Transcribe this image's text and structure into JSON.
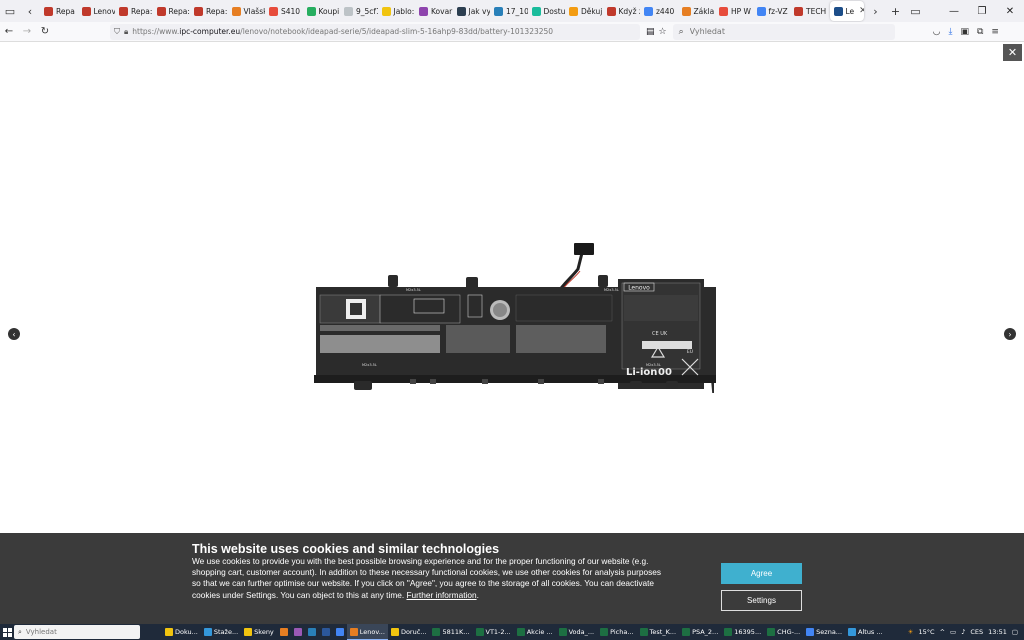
{
  "browser": {
    "tabs": [
      {
        "label": "Repa",
        "color": "#c0392b"
      },
      {
        "label": "Lenov",
        "color": "#c0392b"
      },
      {
        "label": "Repa:",
        "color": "#c0392b"
      },
      {
        "label": "Repa:",
        "color": "#c0392b"
      },
      {
        "label": "Repa:",
        "color": "#c0392b"
      },
      {
        "label": "Vlašsk",
        "color": "#e67e22"
      },
      {
        "label": "S410 (",
        "color": "#e74c3c"
      },
      {
        "label": "Koupi",
        "color": "#27ae60"
      },
      {
        "label": "9_5cf1",
        "color": "#bdc3c7"
      },
      {
        "label": "Jablo:",
        "color": "#f1c40f"
      },
      {
        "label": "Kovar",
        "color": "#8e44ad"
      },
      {
        "label": "Jak vy",
        "color": "#2c3e50"
      },
      {
        "label": "17_10",
        "color": "#2980b9"
      },
      {
        "label": "Dostu",
        "color": "#1abc9c"
      },
      {
        "label": "Děkuj",
        "color": "#f39c12"
      },
      {
        "label": "Když z",
        "color": "#c0392b"
      },
      {
        "label": "z440",
        "color": "#4285f4"
      },
      {
        "label": "Zákla",
        "color": "#e67e22"
      },
      {
        "label": "HP W",
        "color": "#e74c3c"
      },
      {
        "label": "fz-VZ",
        "color": "#4285f4"
      },
      {
        "label": "TECH",
        "color": "#c0392b"
      },
      {
        "label": "Le",
        "color": "#1d4e89",
        "active": true
      }
    ],
    "url_prefix": "https://www.",
    "url_domain": "ipc-computer.eu",
    "url_path": "/lenovo/notebook/ideapad-serie/5/ideapad-slim-5-16ahp9-83dd/battery-101323250",
    "search_placeholder": "Vyhledat"
  },
  "battery_label": {
    "brand": "Lenovo",
    "chem": "Li-ion",
    "screw": "M2x3.5L",
    "eu": "EU"
  },
  "cookie": {
    "title": "This website uses cookies and similar technologies",
    "body": "We use cookies to provide you with the best possible browsing experience and for the proper functioning of our website (e.g. shopping cart, customer account). In addition to these necessary functional cookies, we use other cookies for analysis purposes so that we can further optimise our website. If you click on \"Agree\", you agree to the storage of all cookies. You can deactivate cookies under Settings. You can object to this at any time.",
    "link": "Further information",
    "agree": "Agree",
    "settings": "Settings"
  },
  "taskbar": {
    "search_placeholder": "Vyhledat",
    "items": [
      {
        "label": "Doku...",
        "color": "#f1c40f"
      },
      {
        "label": "Staže...",
        "color": "#3498db"
      },
      {
        "label": "Skeny",
        "color": "#f1c40f"
      },
      {
        "label": "",
        "color": "#e67e22"
      },
      {
        "label": "",
        "color": "#9b59b6"
      },
      {
        "label": "",
        "color": "#2980b9"
      },
      {
        "label": "",
        "color": "#2b579a"
      },
      {
        "label": "",
        "color": "#4285f4"
      },
      {
        "label": "Lenov...",
        "color": "#e67e22",
        "active": true
      },
      {
        "label": "Doruč...",
        "color": "#f1c40f"
      },
      {
        "label": "5811K...",
        "color": "#1d6f42"
      },
      {
        "label": "VT1-2...",
        "color": "#1d6f42"
      },
      {
        "label": "Akcie ...",
        "color": "#1d6f42"
      },
      {
        "label": "Voda_...",
        "color": "#1d6f42"
      },
      {
        "label": "Picha...",
        "color": "#1d6f42"
      },
      {
        "label": "Test_K...",
        "color": "#1d6f42"
      },
      {
        "label": "PSA_2...",
        "color": "#1d6f42"
      },
      {
        "label": "16395...",
        "color": "#1d6f42"
      },
      {
        "label": "CHG-...",
        "color": "#1d6f42"
      },
      {
        "label": "Sezna...",
        "color": "#4285f4"
      },
      {
        "label": "Altus ...",
        "color": "#3498db"
      }
    ],
    "temperature": "15°C",
    "lang": "CES",
    "time": "13:51"
  }
}
